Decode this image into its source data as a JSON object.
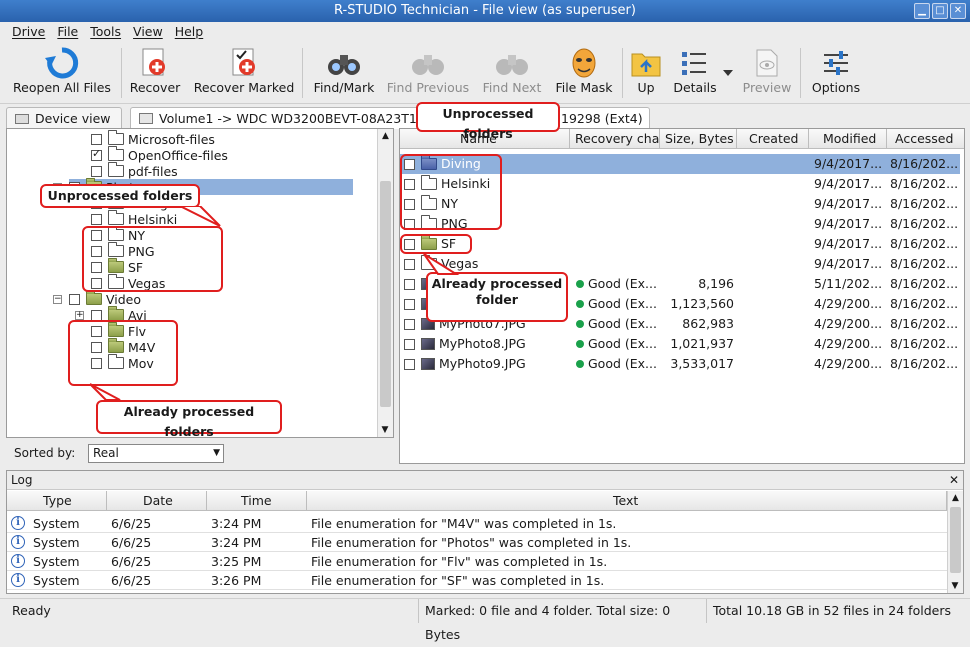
{
  "window": {
    "title": "R-STUDIO Technician - File view (as superuser)"
  },
  "menu": [
    "Drive",
    "File",
    "Tools",
    "View",
    "Help"
  ],
  "toolbar": {
    "reopen": "Reopen All Files",
    "recover": "Recover",
    "recover_marked": "Recover Marked",
    "find_mark": "Find/Mark",
    "find_previous": "Find Previous",
    "find_next": "Find Next",
    "file_mask": "File Mask",
    "up": "Up",
    "details": "Details",
    "preview": "Preview",
    "options": "Options"
  },
  "tabs": {
    "device_view": "Device view",
    "volume_left": "Volume1 -> WDC WD3200BEVT-08A23T1 0",
    "volume_right": "19298 (Ext4)"
  },
  "tree": [
    {
      "label": "Microsoft-files",
      "checked": false,
      "color": "white"
    },
    {
      "label": "OpenOffice-files",
      "checked": true,
      "color": "white"
    },
    {
      "label": "pdf-files",
      "checked": false,
      "color": "white"
    },
    {
      "label": "Photos",
      "checked": false,
      "color": "green"
    },
    {
      "label": "Diving",
      "checked": false,
      "color": "white"
    },
    {
      "label": "Helsinki",
      "checked": false,
      "color": "white"
    },
    {
      "label": "NY",
      "checked": false,
      "color": "white"
    },
    {
      "label": "PNG",
      "checked": false,
      "color": "white"
    },
    {
      "label": "SF",
      "checked": false,
      "color": "green"
    },
    {
      "label": "Vegas",
      "checked": false,
      "color": "white"
    },
    {
      "label": "Video",
      "checked": false,
      "color": "green"
    },
    {
      "label": "Avi",
      "checked": false,
      "color": "green"
    },
    {
      "label": "Flv",
      "checked": false,
      "color": "green"
    },
    {
      "label": "M4V",
      "checked": false,
      "color": "green"
    },
    {
      "label": "Mov",
      "checked": false,
      "color": "white"
    }
  ],
  "sorted_by": {
    "label": "Sorted by:",
    "value": "Real"
  },
  "file_columns": [
    "Name",
    "Recovery char",
    "Size, Bytes",
    "Created",
    "Modified",
    "Accessed"
  ],
  "files": [
    {
      "name": "Diving",
      "type": "folder-blue",
      "recovery": "",
      "size": "",
      "modified": "9/4/2017...",
      "accessed": "8/16/202..."
    },
    {
      "name": "Helsinki",
      "type": "folder",
      "recovery": "",
      "size": "",
      "modified": "9/4/2017...",
      "accessed": "8/16/202..."
    },
    {
      "name": "NY",
      "type": "folder",
      "recovery": "",
      "size": "",
      "modified": "9/4/2017...",
      "accessed": "8/16/202..."
    },
    {
      "name": "PNG",
      "type": "folder",
      "recovery": "",
      "size": "",
      "modified": "9/4/2017...",
      "accessed": "8/16/202..."
    },
    {
      "name": "SF",
      "type": "folder-green",
      "recovery": "",
      "size": "",
      "modified": "9/4/2017...",
      "accessed": "8/16/202..."
    },
    {
      "name": "Vegas",
      "type": "folder",
      "recovery": "",
      "size": "",
      "modified": "9/4/2017...",
      "accessed": "8/16/202..."
    },
    {
      "name": "",
      "type": "file",
      "recovery": "Good (Ex...",
      "size": "8,196",
      "modified": "5/11/202...",
      "accessed": "8/16/202..."
    },
    {
      "name": "",
      "type": "file",
      "recovery": "Good (Ex...",
      "size": "1,123,560",
      "modified": "4/29/200...",
      "accessed": "8/16/202..."
    },
    {
      "name": "MyPhoto7.JPG",
      "type": "file",
      "recovery": "Good (Ex...",
      "size": "862,983",
      "modified": "4/29/200...",
      "accessed": "8/16/202..."
    },
    {
      "name": "MyPhoto8.JPG",
      "type": "file",
      "recovery": "Good (Ex...",
      "size": "1,021,937",
      "modified": "4/29/200...",
      "accessed": "8/16/202..."
    },
    {
      "name": "MyPhoto9.JPG",
      "type": "file",
      "recovery": "Good (Ex...",
      "size": "3,533,017",
      "modified": "4/29/200...",
      "accessed": "8/16/202..."
    }
  ],
  "callouts": {
    "unprocessed_left": "Unprocessed folders",
    "unprocessed_right": "Unprocessed folders",
    "processed_left": "Already processed folders",
    "processed_right_1": "Already processed",
    "processed_right_2": "folder"
  },
  "log": {
    "title": "Log",
    "columns": [
      "Type",
      "Date",
      "Time",
      "Text"
    ],
    "rows": [
      {
        "type": "System",
        "date": "6/6/25",
        "time": "3:24 PM",
        "text": "File enumeration for \"M4V\" was completed in 1s."
      },
      {
        "type": "System",
        "date": "6/6/25",
        "time": "3:24 PM",
        "text": "File enumeration for \"Photos\" was completed in 1s."
      },
      {
        "type": "System",
        "date": "6/6/25",
        "time": "3:25 PM",
        "text": "File enumeration for \"Flv\" was completed in 1s."
      },
      {
        "type": "System",
        "date": "6/6/25",
        "time": "3:26 PM",
        "text": "File enumeration for \"SF\" was completed in 1s."
      }
    ]
  },
  "status": {
    "ready": "Ready",
    "marked": "Marked: 0 file and 4 folder. Total size: 0 Bytes",
    "total": "Total 10.18 GB in 52 files in 24 folders"
  }
}
